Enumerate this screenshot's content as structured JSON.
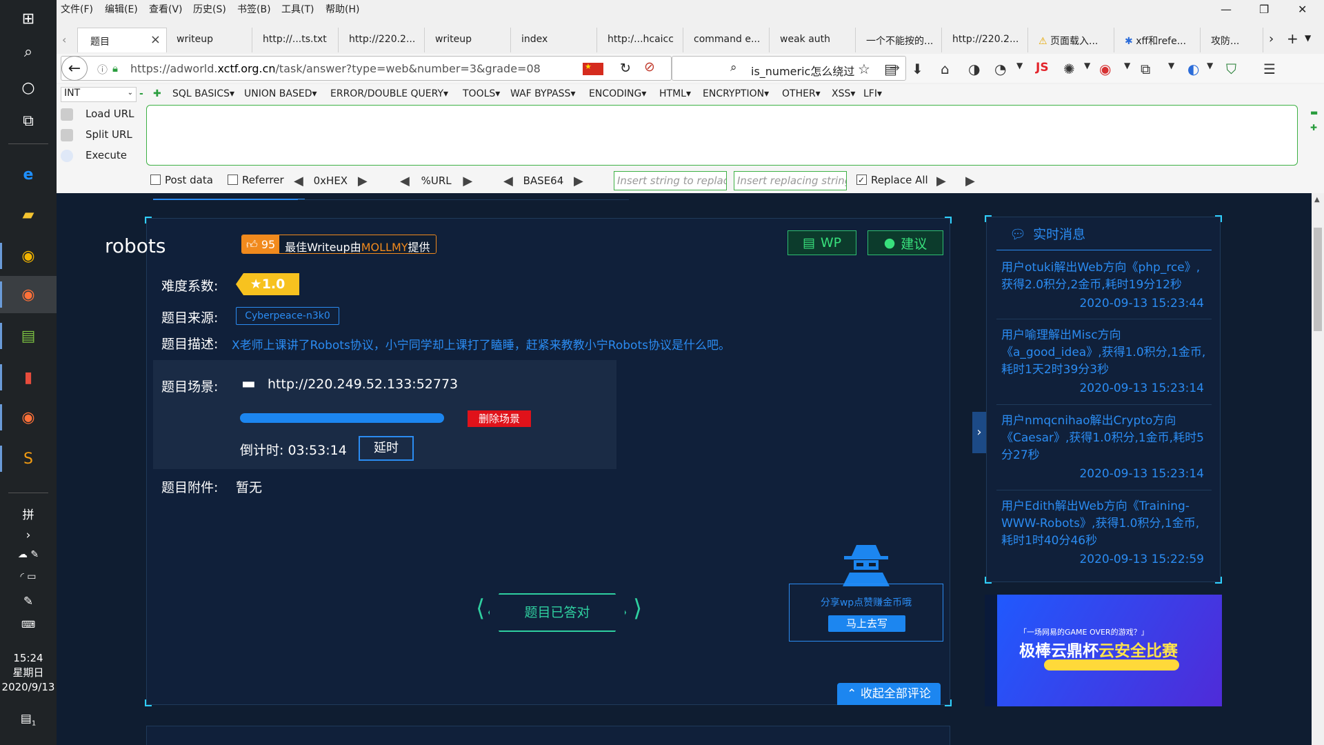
{
  "taskbar": {
    "time": "15:24",
    "weekday": "星期日",
    "date": "2020/9/13",
    "notification_count": "1",
    "ime": "拼"
  },
  "menubar": [
    "文件(F)",
    "编辑(E)",
    "查看(V)",
    "历史(S)",
    "书签(B)",
    "工具(T)",
    "帮助(H)"
  ],
  "tabs": [
    "题目",
    "writeup",
    "http://...ts.txt",
    "http://220.2...",
    "writeup",
    "index",
    "http:/...hcaicc",
    "command e...",
    "weak auth",
    "一个不能按的...",
    "http://220.2...",
    "页面载入...",
    "xff和refe...",
    "攻防..."
  ],
  "url": {
    "prefix": "https://adworld.",
    "domain": "xctf.org.cn",
    "path": "/task/answer?type=web&number=3&grade=08"
  },
  "search": {
    "query": "is_numeric怎么绕过"
  },
  "hackbar": {
    "select_value": "INT",
    "menus": [
      "SQL BASICS",
      "UNION BASED",
      "ERROR/DOUBLE QUERY",
      "TOOLS",
      "WAF BYPASS",
      "ENCODING",
      "HTML",
      "ENCRYPTION",
      "OTHER",
      "XSS",
      "LFI"
    ],
    "load_url": "Load URL",
    "split_url": "Split URL",
    "execute": "Execute",
    "post_data": "Post data",
    "referrer": "Referrer",
    "hex": "0xHEX",
    "url_enc": "%URL",
    "base64": "BASE64",
    "replace_placeholder": "Insert string to replace",
    "replacing_placeholder": "Insert replacing string",
    "replace_all": "Replace All"
  },
  "task": {
    "title": "robots",
    "likes": "95",
    "writeup_prefix": "最佳Writeup由",
    "writeup_author": "MOLLMY",
    "writeup_suffix": "提供",
    "wp_label": "WP",
    "suggest_label": "建议",
    "difficulty_label": "难度系数:",
    "difficulty": "1.0",
    "source_label": "题目来源:",
    "source": "Cyberpeace-n3k0",
    "desc_label": "题目描述:",
    "desc": "X老师上课讲了Robots协议，小宁同学却上课打了瞌睡，赶紧来教教小宁Robots协议是什么吧。",
    "scene_label": "题目场景:",
    "scene_url": "http://220.249.52.133:52773",
    "delete_scene": "删除场景",
    "countdown_label": "倒计时:",
    "countdown": "03:53:14",
    "delay": "延时",
    "attachment_label": "题目附件:",
    "attachment": "暂无",
    "answered": "题目已答对",
    "share_text": "分享wp点赞赚金币哦",
    "share_button": "马上去写",
    "collapse": "收起全部评论"
  },
  "feed": {
    "title": "实时消息",
    "items": [
      {
        "message": "用户otuki解出Web方向《php_rce》,获得2.0积分,2金币,耗时19分12秒",
        "time": "2020-09-13 15:23:44"
      },
      {
        "message": "用户喻理解出Misc方向《a_good_idea》,获得1.0积分,1金币,耗时1天2时39分3秒",
        "time": "2020-09-13 15:23:14"
      },
      {
        "message": "用户nmqcnihao解出Crypto方向《Caesar》,获得1.0积分,1金币,耗时5分27秒",
        "time": "2020-09-13 15:23:14"
      },
      {
        "message": "用户Edith解出Web方向《Training-WWW-Robots》,获得1.0积分,1金币,耗时1时40分46秒",
        "time": "2020-09-13 15:22:59"
      }
    ]
  },
  "banner": {
    "line1": "「一场网易的GAME OVER的游戏？」",
    "line2_prefix": "极棒云鼎杯",
    "line2_highlight": "云安全比赛"
  }
}
